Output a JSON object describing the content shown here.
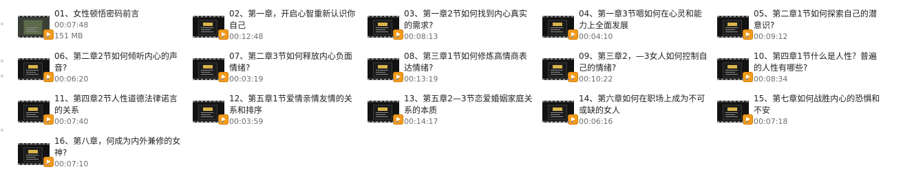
{
  "files": [
    {
      "title": "01、女性顿悟密码前言",
      "duration": "00:07:48",
      "size": "151 MB",
      "thumb": "photo"
    },
    {
      "title": "02、第一章，开启心智重新认识你自己",
      "duration": "00:12:48",
      "thumb": "chapter"
    },
    {
      "title": "03、第一章2节如何找到内心真实的需求?",
      "duration": "00:08:13",
      "thumb": "chapter"
    },
    {
      "title": "04、第一章3节嗯如何在心灵和能力上全面发展",
      "duration": "00:04:10",
      "thumb": "chapter"
    },
    {
      "title": "05、第二章1节如何探索自己的潜意识?",
      "duration": "00:09:12",
      "thumb": "chapter"
    },
    {
      "title": "06、第二章2节如何倾听内心的声音?",
      "duration": "00:06:20",
      "thumb": "chapter"
    },
    {
      "title": "07、第二章3节如何释放内心负面情绪?",
      "duration": "00:03:19",
      "thumb": "chapter"
    },
    {
      "title": "08、第三章1节如何修炼高情商表达情绪?",
      "duration": "00:13:19",
      "thumb": "chapter"
    },
    {
      "title": "09、第三章2，—3女人如何控制自己的情绪?",
      "duration": "00:10:22",
      "thumb": "chapter"
    },
    {
      "title": "10、第四章1节什么是人性？普遍的人性有哪些?",
      "duration": "00:08:34",
      "thumb": "chapter"
    },
    {
      "title": "11、第四章2节人性道德法律诺言的关系",
      "duration": "00:07:40",
      "thumb": "chapter"
    },
    {
      "title": "12、第五章1节爱情亲情友情的关系和排序",
      "duration": "00:03:59",
      "thumb": "chapter"
    },
    {
      "title": "13、第五章2—3节恋爱婚姻家庭关系的本质",
      "duration": "00:14:17",
      "thumb": "chapter"
    },
    {
      "title": "14、第六章如何在职场上成为不可或缺的女人",
      "duration": "00:06:16",
      "thumb": "chapter"
    },
    {
      "title": "15、第七章如何战胜内心的恐惧和不安",
      "duration": "00:07:18",
      "thumb": "chapter"
    },
    {
      "title": "16、第八章，何成为内外兼修的女神?",
      "duration": "00:07:10",
      "thumb": "chapter"
    }
  ]
}
